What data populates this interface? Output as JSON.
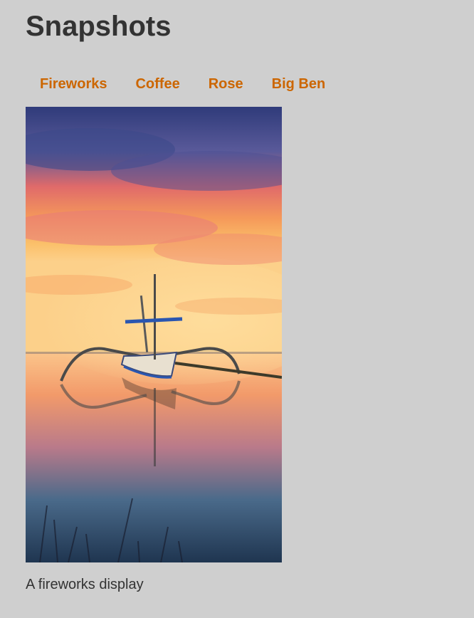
{
  "page": {
    "title": "Snapshots",
    "background": "#cfcfcf",
    "accent": "#cc6600"
  },
  "nav": {
    "items": [
      {
        "label": "Fireworks"
      },
      {
        "label": "Coffee"
      },
      {
        "label": "Rose"
      },
      {
        "label": "Big Ben"
      }
    ]
  },
  "gallery": {
    "caption": "A fireworks display",
    "image_subject": "outrigger boat at sunset reflected in calm water"
  }
}
